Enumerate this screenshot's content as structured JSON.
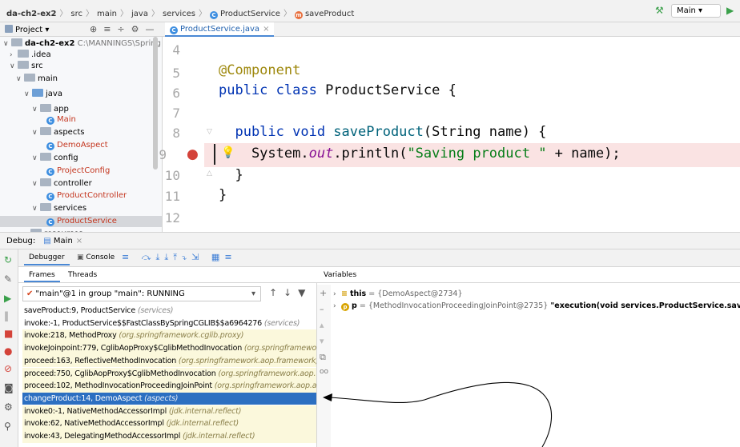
{
  "breadcrumb": {
    "project": "da-ch2-ex2",
    "items": [
      "src",
      "main",
      "java",
      "services",
      "ProductService",
      "saveProduct"
    ]
  },
  "toolbar": {
    "run_config": "Main ▾"
  },
  "project_panel": {
    "title": "Project ▾",
    "tree": [
      {
        "label": "da-ch2-ex2",
        "extra": "C:\\MANNINGS\\Spring Qui",
        "depth": 0
      },
      {
        "label": ".idea",
        "depth": 1
      },
      {
        "label": "src",
        "depth": 1
      },
      {
        "label": "main",
        "depth": 2
      },
      {
        "label": "java",
        "depth": 3
      },
      {
        "label": "app",
        "depth": 4
      },
      {
        "label": "Main",
        "depth": 5
      },
      {
        "label": "aspects",
        "depth": 4
      },
      {
        "label": "DemoAspect",
        "depth": 5
      },
      {
        "label": "config",
        "depth": 4
      },
      {
        "label": "ProjectConfig",
        "depth": 5
      },
      {
        "label": "controller",
        "depth": 4
      },
      {
        "label": "ProductController",
        "depth": 5
      },
      {
        "label": "services",
        "depth": 4
      },
      {
        "label": "ProductService",
        "depth": 5
      },
      {
        "label": "resources",
        "depth": 3
      }
    ]
  },
  "editor": {
    "tab": "ProductService.java",
    "line_numbers": [
      "4",
      "5",
      "6",
      "7",
      "8",
      "9",
      "10",
      "11",
      "12"
    ],
    "code": {
      "l5": "@Component",
      "l6_kw": "public class ",
      "l6_rest": "ProductService {",
      "l8_kw": "  public void ",
      "l8_fn": "saveProduct",
      "l8_rest": "(String name) {",
      "l9_a": "    System.",
      "l9_out": "out",
      "l9_b": ".println(",
      "l9_str": "\"Saving product \"",
      "l9_c": " + name);",
      "l10": "  }",
      "l11": "}"
    }
  },
  "debug": {
    "label": "Debug:",
    "session": "Main",
    "tabs": [
      "Debugger",
      "Console"
    ],
    "subtabs": [
      "Frames",
      "Threads"
    ],
    "variables_tab": "Variables",
    "thread": "\"main\"@1 in group \"main\": RUNNING",
    "frames": [
      {
        "method": "saveProduct:9, ProductService",
        "pkg": "(services)",
        "type": "normal"
      },
      {
        "method": "invoke:-1, ProductService$$FastClassBySpringCGLIB$$a6964276",
        "pkg": "(services)",
        "type": "normal"
      },
      {
        "method": "invoke:218, MethodProxy",
        "pkg": "(org.springframework.cglib.proxy)",
        "type": "lib"
      },
      {
        "method": "invokeJoinpoint:779, CglibAopProxy$CglibMethodInvocation",
        "pkg": "(org.springframework.ao",
        "type": "lib"
      },
      {
        "method": "proceed:163, ReflectiveMethodInvocation",
        "pkg": "(org.springframework.aop.framework)",
        "type": "lib"
      },
      {
        "method": "proceed:750, CglibAopProxy$CglibMethodInvocation",
        "pkg": "(org.springframework.aop.frame",
        "type": "lib"
      },
      {
        "method": "proceed:102, MethodInvocationProceedingJoinPoint",
        "pkg": "(org.springframework.aop.aspectj",
        "type": "lib"
      },
      {
        "method": "changeProduct:14, DemoAspect",
        "pkg": "(aspects)",
        "type": "highlight"
      },
      {
        "method": "invoke0:-1, NativeMethodAccessorImpl",
        "pkg": "(jdk.internal.reflect)",
        "type": "lib"
      },
      {
        "method": "invoke:62, NativeMethodAccessorImpl",
        "pkg": "(jdk.internal.reflect)",
        "type": "lib"
      },
      {
        "method": "invoke:43, DelegatingMethodAccessorImpl",
        "pkg": "(jdk.internal.reflect)",
        "type": "lib"
      }
    ],
    "variables": [
      {
        "name": "this",
        "value": "= {DemoAspect@2734}"
      },
      {
        "name": "p",
        "value": "= {MethodInvocationProceedingJoinPoint@2735}",
        "detail": "\"execution(void services.ProductService.saveProduct(String))\""
      }
    ]
  }
}
